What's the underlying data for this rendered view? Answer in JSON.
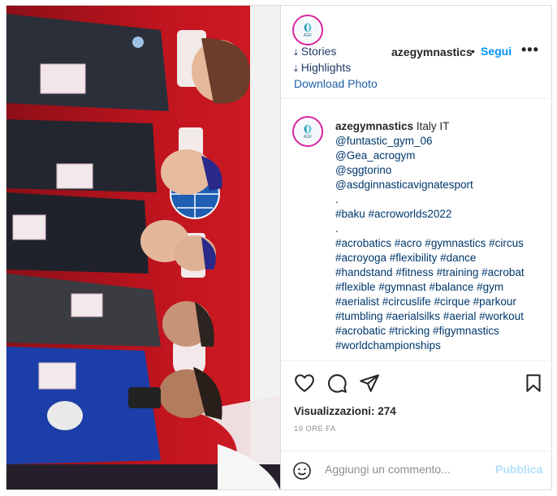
{
  "account": {
    "username": "azegymnastics",
    "avatar_text": "AGF",
    "follow_label": "Segui",
    "separator": "•",
    "more_label": "•••"
  },
  "header_links": {
    "stories": "Stories",
    "highlights": "Highlights",
    "download": "Download Photo"
  },
  "caption": {
    "username": "azegymnastics",
    "location": "Italy IT",
    "lines": [
      {
        "text": "@funtastic_gym_06",
        "kind": "link"
      },
      {
        "text": "@Gea_acrogym",
        "kind": "link"
      },
      {
        "text": "@sggtorino",
        "kind": "link"
      },
      {
        "text": "@asdginnasticavignatesport",
        "kind": "link"
      },
      {
        "text": ".",
        "kind": "plain"
      },
      {
        "text": "#baku #acroworlds2022",
        "kind": "link"
      },
      {
        "text": ".",
        "kind": "plain"
      },
      {
        "text": "#acrobatics #acro #gymnastics #circus",
        "kind": "link"
      },
      {
        "text": "#acroyoga #flexibility #dance",
        "kind": "link"
      },
      {
        "text": "#handstand #fitness #training #acrobat",
        "kind": "link"
      },
      {
        "text": "#flexible #gymnast #balance #gym",
        "kind": "link"
      },
      {
        "text": "#aerialist #circuslife #cirque #parkour",
        "kind": "link"
      },
      {
        "text": "#tumbling #aerialsilks #aerial #workout",
        "kind": "link"
      },
      {
        "text": "#acrobatic #tricking #figymnastics",
        "kind": "link"
      },
      {
        "text": "#worldchampionships",
        "kind": "link"
      }
    ]
  },
  "actions": {
    "icons": [
      "heart-icon",
      "comment-icon",
      "share-icon",
      "bookmark-icon"
    ]
  },
  "stats": {
    "views": "Visualizzazioni: 274",
    "time": "19 ORE FA"
  },
  "comment_box": {
    "placeholder": "Aggiungi un commento...",
    "publish_label": "Pubblica"
  },
  "colors": {
    "accent": "#0095f6",
    "link": "#00376b",
    "publish_disabled": "#b2dffc",
    "backdrop_red": "#b1131f"
  }
}
